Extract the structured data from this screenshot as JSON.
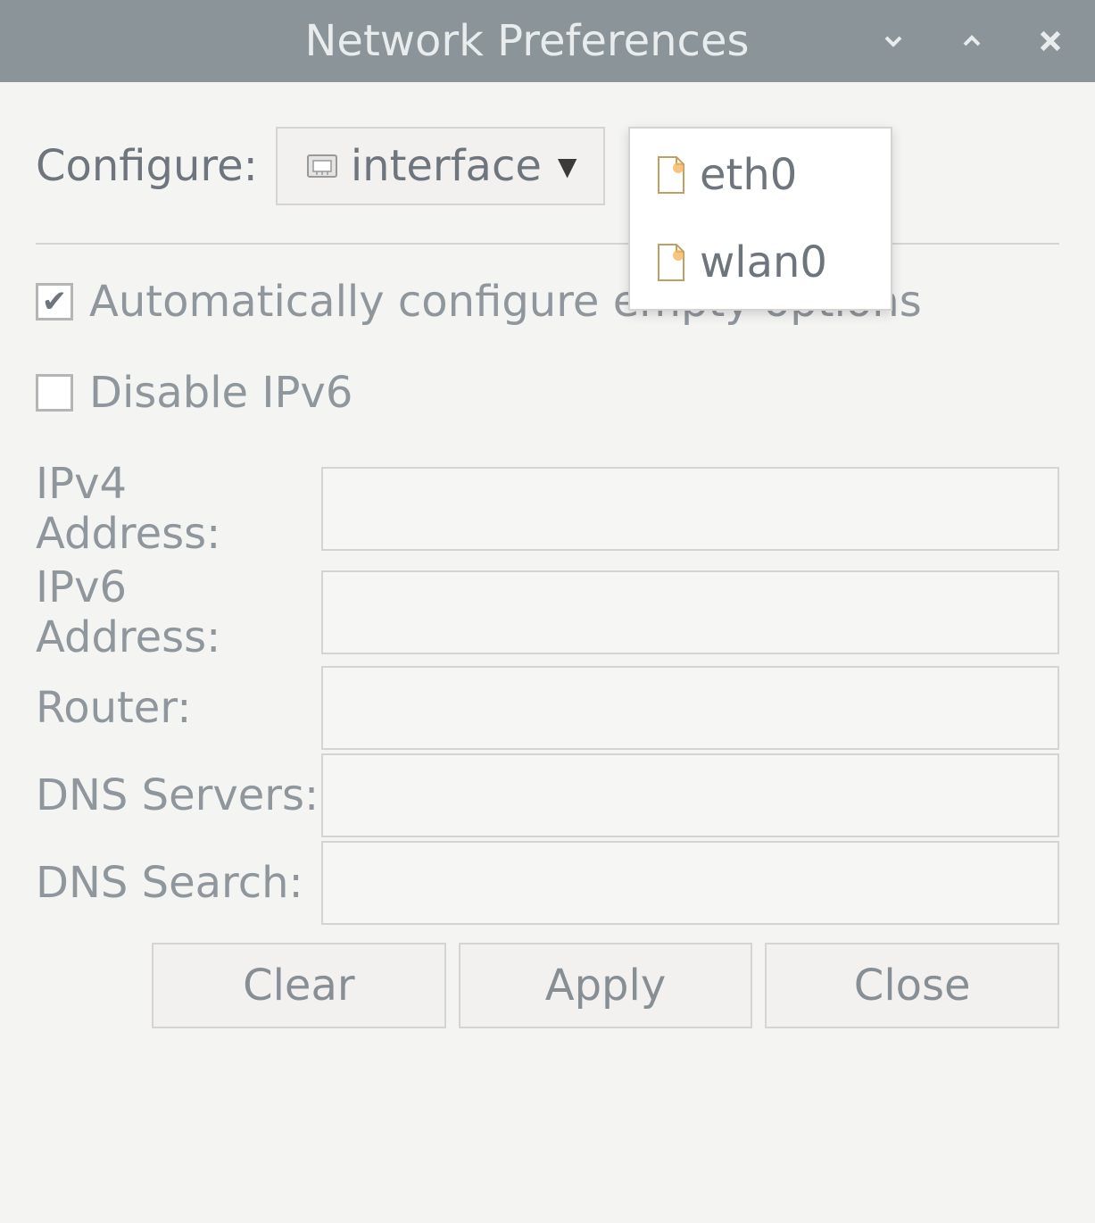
{
  "titlebar": {
    "title": "Network Preferences"
  },
  "configure": {
    "label": "Configure:",
    "dropdown_label": "interface",
    "menu": [
      "eth0",
      "wlan0"
    ]
  },
  "checkboxes": {
    "auto_configure": {
      "label": "Automatically configure empty options",
      "checked": true
    },
    "disable_ipv6": {
      "label": "Disable IPv6",
      "checked": false
    }
  },
  "fields": {
    "ipv4": {
      "label": "IPv4 Address:",
      "value": ""
    },
    "ipv6": {
      "label": "IPv6 Address:",
      "value": ""
    },
    "router": {
      "label": "Router:",
      "value": ""
    },
    "dns_servers": {
      "label": "DNS Servers:",
      "value": ""
    },
    "dns_search": {
      "label": "DNS Search:",
      "value": ""
    }
  },
  "buttons": {
    "clear": "Clear",
    "apply": "Apply",
    "close": "Close"
  }
}
